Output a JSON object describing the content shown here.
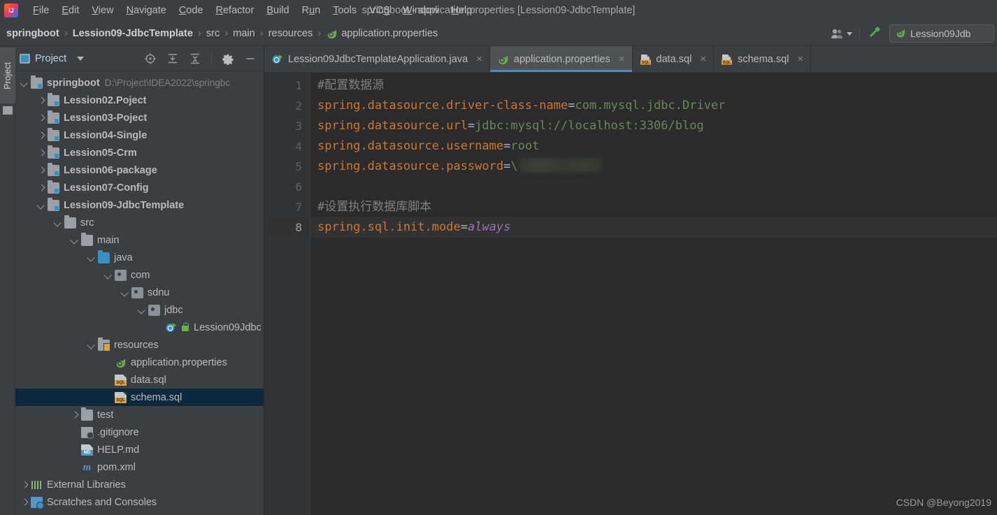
{
  "window": {
    "title": "springboot - application.properties [Lession09-JdbcTemplate]",
    "logo_alt": "intellij-idea-logo"
  },
  "menu": [
    {
      "label": "File",
      "mnemonic": "F"
    },
    {
      "label": "Edit",
      "mnemonic": "E"
    },
    {
      "label": "View",
      "mnemonic": "V"
    },
    {
      "label": "Navigate",
      "mnemonic": "N"
    },
    {
      "label": "Code",
      "mnemonic": "C"
    },
    {
      "label": "Refactor",
      "mnemonic": "R"
    },
    {
      "label": "Build",
      "mnemonic": "B"
    },
    {
      "label": "Run",
      "mnemonic": "u"
    },
    {
      "label": "Tools",
      "mnemonic": "T"
    },
    {
      "label": "VCS",
      "mnemonic": "S"
    },
    {
      "label": "Window",
      "mnemonic": "W"
    },
    {
      "label": "Help",
      "mnemonic": "H"
    }
  ],
  "breadcrumb": [
    {
      "label": "springboot",
      "bold": true
    },
    {
      "label": "Lession09-JdbcTemplate",
      "bold": true
    },
    {
      "label": "src",
      "bold": false
    },
    {
      "label": "main",
      "bold": false
    },
    {
      "label": "resources",
      "bold": false
    },
    {
      "label": "application.properties",
      "bold": false
    }
  ],
  "navbar_right": {
    "run_config": "Lession09Jdb",
    "people_icon": "people-icon",
    "build_icon": "hammer-icon"
  },
  "left_strip": {
    "project_tab": "Project"
  },
  "project_panel": {
    "title": "Project",
    "tools": [
      {
        "name": "locate-icon"
      },
      {
        "name": "expand-all-icon"
      },
      {
        "name": "collapse-all-icon"
      },
      {
        "name": "settings-gear-icon"
      },
      {
        "name": "hide-minimize-icon"
      }
    ],
    "tree": [
      {
        "label": "springboot",
        "path": "D:\\Project\\IDEA2022\\springbc",
        "indent": 0,
        "arrow": "down",
        "icon": "module",
        "bold": true,
        "selected": false
      },
      {
        "label": "Lession02.Poject",
        "indent": 1,
        "arrow": "right",
        "icon": "module",
        "bold": true,
        "selected": false
      },
      {
        "label": "Lession03-Poject",
        "indent": 1,
        "arrow": "right",
        "icon": "module",
        "bold": true,
        "selected": false
      },
      {
        "label": "Lession04-Single",
        "indent": 1,
        "arrow": "right",
        "icon": "module",
        "bold": true,
        "selected": false
      },
      {
        "label": "Lession05-Crm",
        "indent": 1,
        "arrow": "right",
        "icon": "module",
        "bold": true,
        "selected": false
      },
      {
        "label": "Lession06-package",
        "indent": 1,
        "arrow": "right",
        "icon": "module",
        "bold": true,
        "selected": false
      },
      {
        "label": "Lession07-Config",
        "indent": 1,
        "arrow": "right",
        "icon": "module",
        "bold": true,
        "selected": false
      },
      {
        "label": "Lession09-JdbcTemplate",
        "indent": 1,
        "arrow": "down",
        "icon": "module",
        "bold": true,
        "selected": false
      },
      {
        "label": "src",
        "indent": 2,
        "arrow": "down",
        "icon": "folder",
        "bold": false,
        "selected": false
      },
      {
        "label": "main",
        "indent": 3,
        "arrow": "down",
        "icon": "folder",
        "bold": false,
        "selected": false
      },
      {
        "label": "java",
        "indent": 4,
        "arrow": "down",
        "icon": "source-folder",
        "bold": false,
        "selected": false
      },
      {
        "label": "com",
        "indent": 5,
        "arrow": "down",
        "icon": "package",
        "bold": false,
        "selected": false
      },
      {
        "label": "sdnu",
        "indent": 6,
        "arrow": "down",
        "icon": "package",
        "bold": false,
        "selected": false
      },
      {
        "label": "jdbc",
        "indent": 7,
        "arrow": "down",
        "icon": "package",
        "bold": false,
        "selected": false
      },
      {
        "label": "Lession09Jdbc",
        "indent": 8,
        "arrow": "none",
        "icon": "spring-boot-class",
        "bold": false,
        "selected": false,
        "lock": true
      },
      {
        "label": "resources",
        "indent": 4,
        "arrow": "down",
        "icon": "resources-folder",
        "bold": false,
        "selected": false
      },
      {
        "label": "application.properties",
        "indent": 5,
        "arrow": "none",
        "icon": "spring-properties",
        "bold": false,
        "selected": false
      },
      {
        "label": "data.sql",
        "indent": 5,
        "arrow": "none",
        "icon": "sql-file",
        "bold": false,
        "selected": false
      },
      {
        "label": "schema.sql",
        "indent": 5,
        "arrow": "none",
        "icon": "sql-file",
        "bold": false,
        "selected": true
      },
      {
        "label": "test",
        "indent": 3,
        "arrow": "right",
        "icon": "folder",
        "bold": false,
        "selected": false
      },
      {
        "label": ".gitignore",
        "indent": 3,
        "arrow": "none",
        "icon": "gitignore-file",
        "bold": false,
        "selected": false
      },
      {
        "label": "HELP.md",
        "indent": 3,
        "arrow": "none",
        "icon": "markdown-file",
        "bold": false,
        "selected": false
      },
      {
        "label": "pom.xml",
        "indent": 3,
        "arrow": "none",
        "icon": "maven-file",
        "bold": false,
        "selected": false
      },
      {
        "label": "External Libraries",
        "indent": 0,
        "arrow": "right",
        "icon": "external-libraries",
        "bold": false,
        "selected": false
      },
      {
        "label": "Scratches and Consoles",
        "indent": 0,
        "arrow": "right",
        "icon": "scratches",
        "bold": false,
        "selected": false
      }
    ]
  },
  "editor": {
    "tabs": [
      {
        "label": "Lession09JdbcTemplateApplication.java",
        "icon": "spring-boot-class-icon",
        "active": false,
        "close": "×"
      },
      {
        "label": "application.properties",
        "icon": "spring-properties-icon",
        "active": true,
        "close": "×"
      },
      {
        "label": "data.sql",
        "icon": "sql-file-icon",
        "active": false,
        "close": "×"
      },
      {
        "label": "schema.sql",
        "icon": "sql-file-icon",
        "active": false,
        "close": "×"
      }
    ],
    "line_numbers": [
      "1",
      "2",
      "3",
      "4",
      "5",
      "6",
      "7",
      "8"
    ],
    "caret_line": 8,
    "lines": [
      {
        "n": 1,
        "type": "comment",
        "text": "#配置数据源"
      },
      {
        "n": 2,
        "type": "prop",
        "key": "spring.datasource.driver-class-name",
        "value": "com.mysql.jdbc.Driver",
        "value_style": "plain"
      },
      {
        "n": 3,
        "type": "prop",
        "key": "spring.datasource.url",
        "value": "jdbc:mysql://localhost:3306/blog",
        "value_style": "plain"
      },
      {
        "n": 4,
        "type": "prop",
        "key": "spring.datasource.username",
        "value": "root",
        "value_style": "plain"
      },
      {
        "n": 5,
        "type": "prop-redacted",
        "key": "spring.datasource.password",
        "value": "\\",
        "value_style": "redacted"
      },
      {
        "n": 6,
        "type": "blank",
        "text": ""
      },
      {
        "n": 7,
        "type": "comment",
        "text": "#设置执行数据库脚本"
      },
      {
        "n": 8,
        "type": "prop",
        "key": "spring.sql.init.mode",
        "value": "always",
        "value_style": "italic-keyword"
      }
    ]
  },
  "watermark": "CSDN @Beyong2019",
  "colors": {
    "window_bg": "#3c3f41",
    "editor_bg": "#2b2b2b",
    "gutter_bg": "#313335",
    "selection_blue": "#0d293e",
    "tab_active": "#4e5254",
    "tab_underline": "#4a88c7",
    "key_orange": "#cc7832",
    "value_green": "#6a8759",
    "keyword_purple": "#9876aa",
    "comment_gray": "#808080"
  }
}
